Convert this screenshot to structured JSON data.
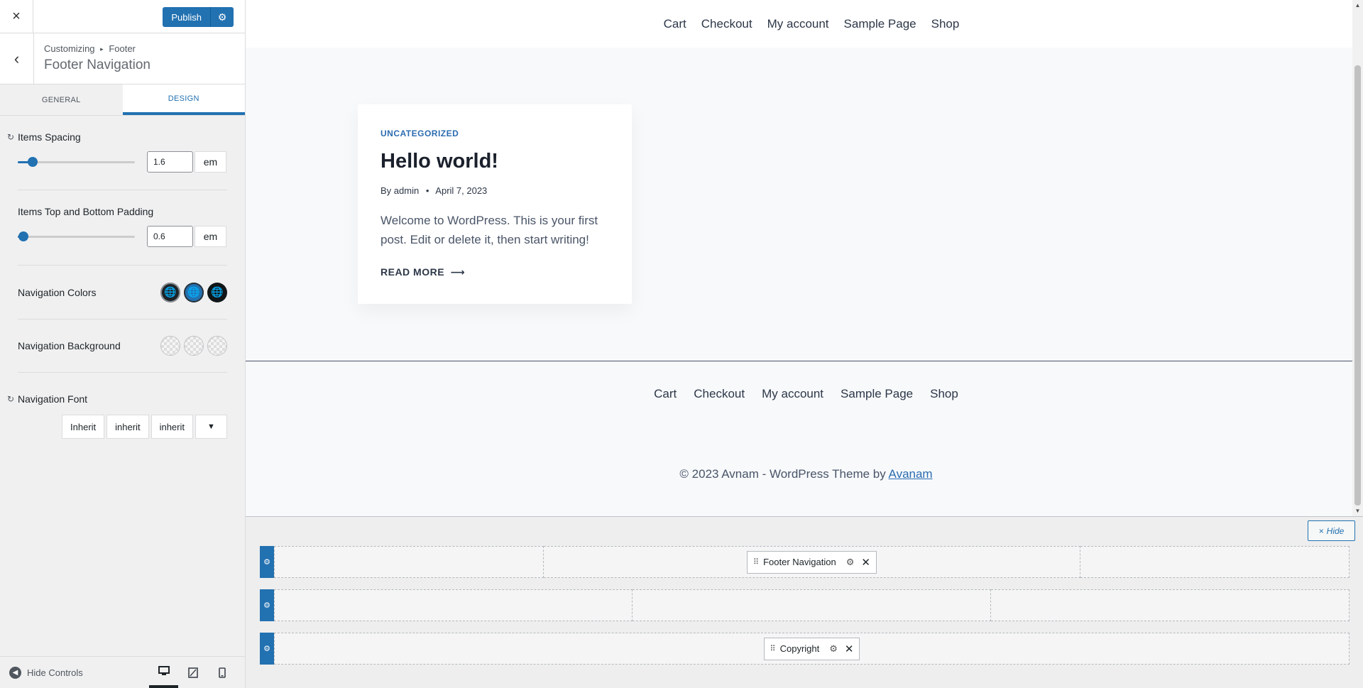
{
  "topbar": {
    "close_icon": "×",
    "publish_label": "Publish",
    "publish_gear_icon": "⚙"
  },
  "section": {
    "back_icon": "‹",
    "breadcrumb_root": "Customizing",
    "breadcrumb_sep": "▸",
    "breadcrumb_parent": "Footer",
    "title": "Footer Navigation"
  },
  "tabs": [
    {
      "label": "GENERAL",
      "active": false
    },
    {
      "label": "DESIGN",
      "active": true
    }
  ],
  "controls": {
    "items_spacing": {
      "label": "Items Spacing",
      "value": "1.6",
      "unit": "em",
      "slider_fraction": 0.13
    },
    "items_padding": {
      "label": "Items Top and Bottom Padding",
      "value": "0.6",
      "unit": "em",
      "slider_fraction": 0.05
    },
    "nav_colors": {
      "label": "Navigation Colors"
    },
    "nav_background": {
      "label": "Navigation Background"
    },
    "nav_font": {
      "label": "Navigation Font",
      "family": "Inherit",
      "weight": "inherit",
      "style": "inherit",
      "dropdown_icon": "▼"
    },
    "reset_icon": "↻",
    "globe_icon": "🌐"
  },
  "sidebar_footer": {
    "hide_controls_label": "Hide Controls",
    "hide_icon": "◀",
    "devices": [
      "desktop-icon",
      "tablet-icon",
      "mobile-icon"
    ]
  },
  "preview": {
    "header_nav": [
      "Cart",
      "Checkout",
      "My account",
      "Sample Page",
      "Shop"
    ],
    "post": {
      "category": "UNCATEGORIZED",
      "title": "Hello world!",
      "author": "By admin",
      "meta_sep": "•",
      "date": "April 7, 2023",
      "excerpt": "Welcome to WordPress. This is your first post. Edit or delete it, then start writing!",
      "read_more": "READ MORE",
      "read_more_arrow": "⟶"
    },
    "footer_nav": [
      "Cart",
      "Checkout",
      "My account",
      "Sample Page",
      "Shop"
    ],
    "copyright_text": "© 2023 Avnam - WordPress Theme by ",
    "copyright_link": "Avanam"
  },
  "builder": {
    "hide_label": "Hide",
    "hide_icon": "×",
    "row_gear_icon": "⚙",
    "top_item": "Footer Navigation",
    "bottom_item": "Copyright",
    "grip_icon": "⠿",
    "item_gear_icon": "⚙",
    "item_close_icon": "✕"
  },
  "colors": {
    "accent": "#2271b1",
    "link": "#2b6cb0"
  }
}
